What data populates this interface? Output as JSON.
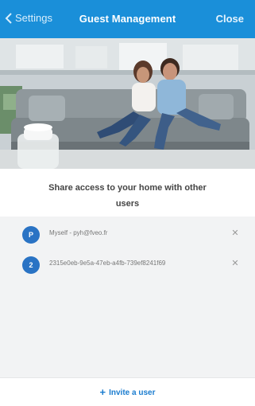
{
  "navbar": {
    "back_label": "Settings",
    "title": "Guest Management",
    "close_label": "Close"
  },
  "intro": {
    "text": "Share access to your home with other users"
  },
  "users": [
    {
      "avatar_letter": "P",
      "label": "Myself - pyh@fveo.fr"
    },
    {
      "avatar_letter": "2",
      "label": "2315e0eb-9e5a-47eb-a4fb-739ef8241f69"
    }
  ],
  "footer": {
    "invite_label": "Invite a user"
  },
  "colors": {
    "brand": "#1a8fd9",
    "avatar": "#2a73c4",
    "link": "#1a7ccf"
  }
}
